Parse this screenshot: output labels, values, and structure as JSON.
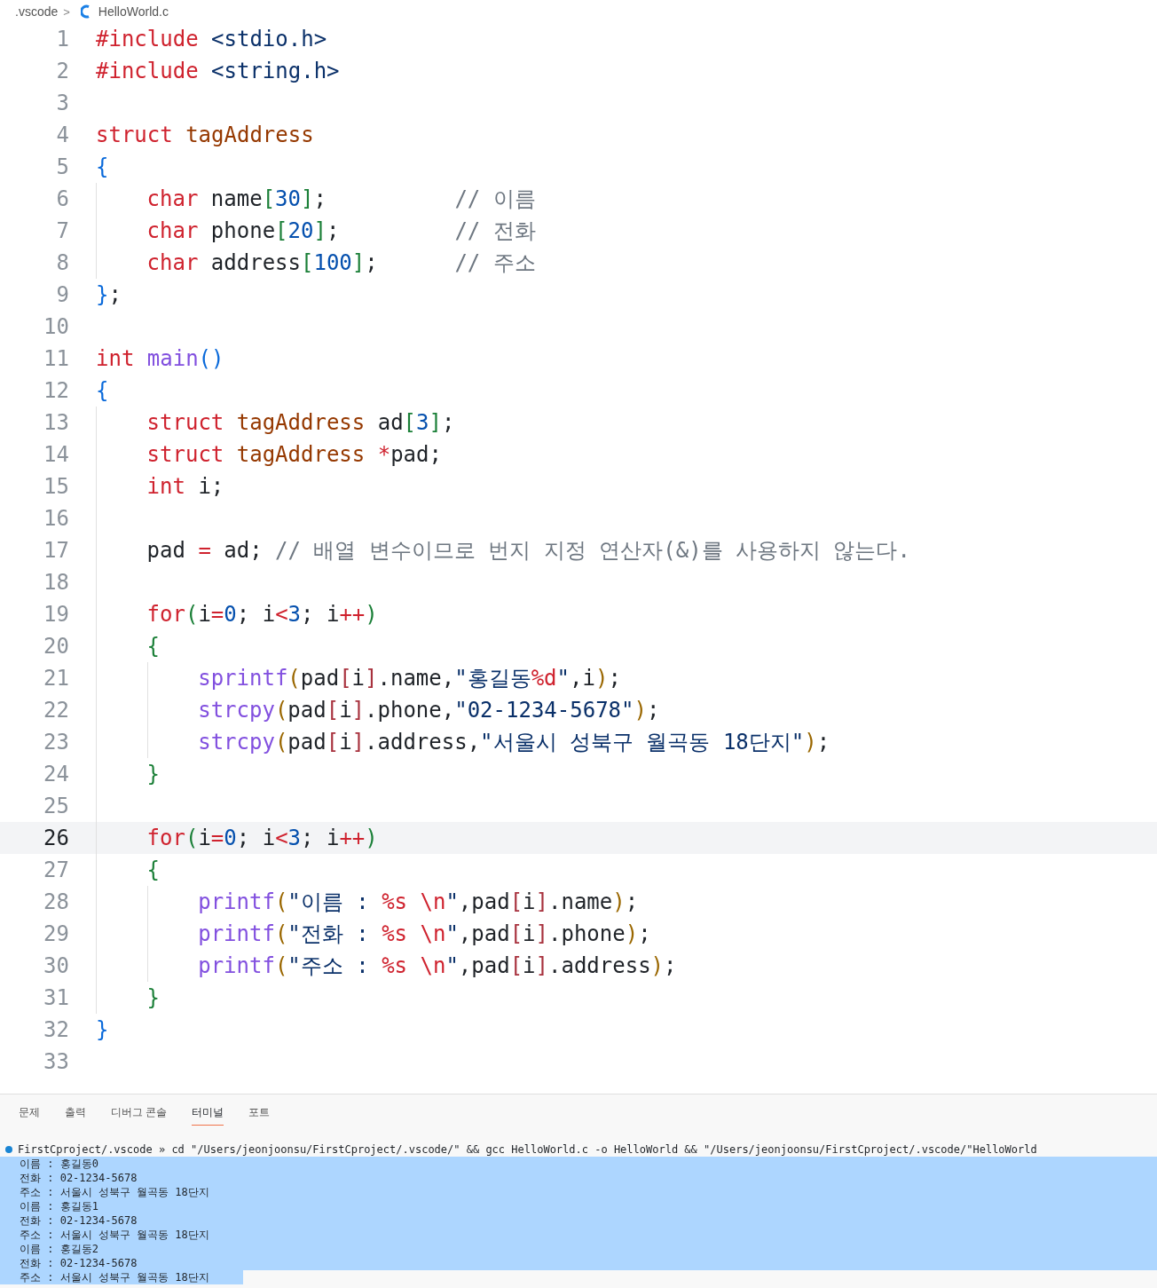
{
  "breadcrumb": {
    "folder": ".vscode",
    "separator": ">",
    "file": "HelloWorld.c"
  },
  "lines": [
    {
      "number": "1",
      "current": false,
      "tokens": [
        {
          "kind": "kw",
          "text": "#include "
        },
        {
          "kind": "str",
          "text": "<stdio.h>"
        }
      ]
    },
    {
      "number": "2",
      "current": false,
      "tokens": [
        {
          "kind": "kw",
          "text": "#include "
        },
        {
          "kind": "str",
          "text": "<string.h>"
        }
      ]
    },
    {
      "number": "3",
      "current": false
    },
    {
      "number": "4",
      "current": false,
      "tokens": [
        {
          "kind": "kw",
          "text": "struct "
        },
        {
          "kind": "type",
          "text": "tagAddress"
        }
      ]
    },
    {
      "number": "5",
      "current": false,
      "tokens": [
        {
          "kind": "b1",
          "text": "{"
        }
      ],
      "children": [
        {
          "number": "6",
          "current": false,
          "tokens": [
            {
              "kind": "kw",
              "text": "char"
            },
            {
              "kind": "p",
              "text": " name"
            },
            {
              "kind": "b2",
              "text": "["
            },
            {
              "kind": "num",
              "text": "30"
            },
            {
              "kind": "b2",
              "text": "]"
            },
            {
              "kind": "p",
              "text": ";          "
            },
            {
              "kind": "cm",
              "text": "// 이름"
            }
          ]
        },
        {
          "number": "7",
          "current": false,
          "tokens": [
            {
              "kind": "kw",
              "text": "char"
            },
            {
              "kind": "p",
              "text": " phone"
            },
            {
              "kind": "b2",
              "text": "["
            },
            {
              "kind": "num",
              "text": "20"
            },
            {
              "kind": "b2",
              "text": "]"
            },
            {
              "kind": "p",
              "text": ";         "
            },
            {
              "kind": "cm",
              "text": "// 전화"
            }
          ]
        },
        {
          "number": "8",
          "current": false,
          "tokens": [
            {
              "kind": "kw",
              "text": "char"
            },
            {
              "kind": "p",
              "text": " address"
            },
            {
              "kind": "b2",
              "text": "["
            },
            {
              "kind": "num",
              "text": "100"
            },
            {
              "kind": "b2",
              "text": "]"
            },
            {
              "kind": "p",
              "text": ";      "
            },
            {
              "kind": "cm",
              "text": "// 주소"
            }
          ]
        }
      ]
    },
    {
      "number": "9",
      "current": false,
      "tokens": [
        {
          "kind": "b1",
          "text": "}"
        },
        {
          "kind": "p",
          "text": ";"
        }
      ]
    },
    {
      "number": "10",
      "current": false
    },
    {
      "number": "11",
      "current": false,
      "tokens": [
        {
          "kind": "kw",
          "text": "int "
        },
        {
          "kind": "fn",
          "text": "main"
        },
        {
          "kind": "b1",
          "text": "()"
        }
      ]
    },
    {
      "number": "12",
      "current": false,
      "tokens": [
        {
          "kind": "b1",
          "text": "{"
        }
      ],
      "children": [
        {
          "number": "13",
          "current": false,
          "tokens": [
            {
              "kind": "kw",
              "text": "struct "
            },
            {
              "kind": "type",
              "text": "tagAddress"
            },
            {
              "kind": "p",
              "text": " ad"
            },
            {
              "kind": "b2",
              "text": "["
            },
            {
              "kind": "num",
              "text": "3"
            },
            {
              "kind": "b2",
              "text": "]"
            },
            {
              "kind": "p",
              "text": ";"
            }
          ]
        },
        {
          "number": "14",
          "current": false,
          "tokens": [
            {
              "kind": "kw",
              "text": "struct "
            },
            {
              "kind": "type",
              "text": "tagAddress "
            },
            {
              "kind": "op",
              "text": "*"
            },
            {
              "kind": "p",
              "text": "pad;"
            }
          ]
        },
        {
          "number": "15",
          "current": false,
          "tokens": [
            {
              "kind": "kw",
              "text": "int"
            },
            {
              "kind": "p",
              "text": " i;"
            }
          ]
        },
        {
          "number": "16",
          "current": false
        },
        {
          "number": "17",
          "current": false,
          "tokens": [
            {
              "kind": "p",
              "text": "pad "
            },
            {
              "kind": "op",
              "text": "="
            },
            {
              "kind": "p",
              "text": " ad; "
            },
            {
              "kind": "cm",
              "text": "// 배열 변수이므로 번지 지정 연산자(&)를 사용하지 않는다."
            }
          ]
        },
        {
          "number": "18",
          "current": false
        },
        {
          "number": "19",
          "current": false,
          "tokens": [
            {
              "kind": "kw",
              "text": "for"
            },
            {
              "kind": "b2",
              "text": "("
            },
            {
              "kind": "p",
              "text": "i"
            },
            {
              "kind": "op",
              "text": "="
            },
            {
              "kind": "num",
              "text": "0"
            },
            {
              "kind": "p",
              "text": "; i"
            },
            {
              "kind": "op",
              "text": "<"
            },
            {
              "kind": "num",
              "text": "3"
            },
            {
              "kind": "p",
              "text": "; i"
            },
            {
              "kind": "op",
              "text": "++"
            },
            {
              "kind": "b2",
              "text": ")"
            }
          ]
        },
        {
          "number": "20",
          "current": false,
          "tokens": [
            {
              "kind": "b2",
              "text": "{"
            }
          ],
          "children": [
            {
              "number": "21",
              "current": false,
              "tokens": [
                {
                  "kind": "fn",
                  "text": "sprintf"
                },
                {
                  "kind": "b3",
                  "text": "("
                },
                {
                  "kind": "p",
                  "text": "pad"
                },
                {
                  "kind": "b4",
                  "text": "["
                },
                {
                  "kind": "p",
                  "text": "i"
                },
                {
                  "kind": "b4",
                  "text": "]"
                },
                {
                  "kind": "p",
                  "text": ".name,"
                },
                {
                  "kind": "str",
                  "text": "\"홍길동"
                },
                {
                  "kind": "op",
                  "text": "%d"
                },
                {
                  "kind": "str",
                  "text": "\""
                },
                {
                  "kind": "p",
                  "text": ",i"
                },
                {
                  "kind": "b3",
                  "text": ")"
                },
                {
                  "kind": "p",
                  "text": ";"
                }
              ]
            },
            {
              "number": "22",
              "current": false,
              "tokens": [
                {
                  "kind": "fn",
                  "text": "strcpy"
                },
                {
                  "kind": "b3",
                  "text": "("
                },
                {
                  "kind": "p",
                  "text": "pad"
                },
                {
                  "kind": "b4",
                  "text": "["
                },
                {
                  "kind": "p",
                  "text": "i"
                },
                {
                  "kind": "b4",
                  "text": "]"
                },
                {
                  "kind": "p",
                  "text": ".phone,"
                },
                {
                  "kind": "str",
                  "text": "\"02-1234-5678\""
                },
                {
                  "kind": "b3",
                  "text": ")"
                },
                {
                  "kind": "p",
                  "text": ";"
                }
              ]
            },
            {
              "number": "23",
              "current": false,
              "tokens": [
                {
                  "kind": "fn",
                  "text": "strcpy"
                },
                {
                  "kind": "b3",
                  "text": "("
                },
                {
                  "kind": "p",
                  "text": "pad"
                },
                {
                  "kind": "b4",
                  "text": "["
                },
                {
                  "kind": "p",
                  "text": "i"
                },
                {
                  "kind": "b4",
                  "text": "]"
                },
                {
                  "kind": "p",
                  "text": ".address,"
                },
                {
                  "kind": "str",
                  "text": "\"서울시 성북구 월곡동 18단지\""
                },
                {
                  "kind": "b3",
                  "text": ")"
                },
                {
                  "kind": "p",
                  "text": ";"
                }
              ]
            }
          ]
        },
        {
          "number": "24",
          "current": false,
          "tokens": [
            {
              "kind": "b2",
              "text": "}"
            }
          ]
        },
        {
          "number": "25",
          "current": false
        },
        {
          "number": "26",
          "current": true,
          "tokens": [
            {
              "kind": "kw",
              "text": "for"
            },
            {
              "kind": "b2",
              "text": "("
            },
            {
              "kind": "p",
              "text": "i"
            },
            {
              "kind": "op",
              "text": "="
            },
            {
              "kind": "num",
              "text": "0"
            },
            {
              "kind": "p",
              "text": "; i"
            },
            {
              "kind": "op",
              "text": "<"
            },
            {
              "kind": "num",
              "text": "3"
            },
            {
              "kind": "p",
              "text": "; i"
            },
            {
              "kind": "op",
              "text": "++"
            },
            {
              "kind": "b2",
              "text": ")"
            }
          ]
        },
        {
          "number": "27",
          "current": false,
          "tokens": [
            {
              "kind": "b2",
              "text": "{"
            }
          ],
          "children": [
            {
              "number": "28",
              "current": false,
              "tokens": [
                {
                  "kind": "fn",
                  "text": "printf"
                },
                {
                  "kind": "b3",
                  "text": "("
                },
                {
                  "kind": "str",
                  "text": "\"이름 : "
                },
                {
                  "kind": "op",
                  "text": "%s"
                },
                {
                  "kind": "op",
                  "text": " \\n"
                },
                {
                  "kind": "str",
                  "text": "\""
                },
                {
                  "kind": "p",
                  "text": ",pad"
                },
                {
                  "kind": "b4",
                  "text": "["
                },
                {
                  "kind": "p",
                  "text": "i"
                },
                {
                  "kind": "b4",
                  "text": "]"
                },
                {
                  "kind": "p",
                  "text": ".name"
                },
                {
                  "kind": "b3",
                  "text": ")"
                },
                {
                  "kind": "p",
                  "text": ";"
                }
              ]
            },
            {
              "number": "29",
              "current": false,
              "tokens": [
                {
                  "kind": "fn",
                  "text": "printf"
                },
                {
                  "kind": "b3",
                  "text": "("
                },
                {
                  "kind": "str",
                  "text": "\"전화 : "
                },
                {
                  "kind": "op",
                  "text": "%s"
                },
                {
                  "kind": "op",
                  "text": " \\n"
                },
                {
                  "kind": "str",
                  "text": "\""
                },
                {
                  "kind": "p",
                  "text": ",pad"
                },
                {
                  "kind": "b4",
                  "text": "["
                },
                {
                  "kind": "p",
                  "text": "i"
                },
                {
                  "kind": "b4",
                  "text": "]"
                },
                {
                  "kind": "p",
                  "text": ".phone"
                },
                {
                  "kind": "b3",
                  "text": ")"
                },
                {
                  "kind": "p",
                  "text": ";"
                }
              ]
            },
            {
              "number": "30",
              "current": false,
              "tokens": [
                {
                  "kind": "fn",
                  "text": "printf"
                },
                {
                  "kind": "b3",
                  "text": "("
                },
                {
                  "kind": "str",
                  "text": "\"주소 : "
                },
                {
                  "kind": "op",
                  "text": "%s"
                },
                {
                  "kind": "op",
                  "text": " \\n"
                },
                {
                  "kind": "str",
                  "text": "\""
                },
                {
                  "kind": "p",
                  "text": ",pad"
                },
                {
                  "kind": "b4",
                  "text": "["
                },
                {
                  "kind": "p",
                  "text": "i"
                },
                {
                  "kind": "b4",
                  "text": "]"
                },
                {
                  "kind": "p",
                  "text": ".address"
                },
                {
                  "kind": "b3",
                  "text": ")"
                },
                {
                  "kind": "p",
                  "text": ";"
                }
              ]
            }
          ]
        },
        {
          "number": "31",
          "current": false,
          "tokens": [
            {
              "kind": "b2",
              "text": "}"
            }
          ]
        }
      ]
    },
    {
      "number": "32",
      "current": false,
      "tokens": [
        {
          "kind": "b1",
          "text": "}"
        }
      ]
    },
    {
      "number": "33",
      "current": false
    }
  ],
  "panel_tabs": [
    {
      "label": "문제",
      "selected": false
    },
    {
      "label": "출력",
      "selected": false
    },
    {
      "label": "디버그 콘솔",
      "selected": false
    },
    {
      "label": "터미널",
      "selected": true
    },
    {
      "label": "포트",
      "selected": false
    }
  ],
  "terminal": {
    "command": "FirstCproject/.vscode » cd \"/Users/jeonjoonsu/FirstCproject/.vscode/\" && gcc HelloWorld.c -o HelloWorld && \"/Users/jeonjoonsu/FirstCproject/.vscode/\"HelloWorld",
    "output": [
      {
        "text": "이름 : 홍길동0",
        "selected": true
      },
      {
        "text": "전화 : 02-1234-5678",
        "selected": true
      },
      {
        "text": "주소 : 서울시 성북구 월곡동 18단지",
        "selected": true
      },
      {
        "text": "이름 : 홍길동1",
        "selected": true
      },
      {
        "text": "전화 : 02-1234-5678",
        "selected": true
      },
      {
        "text": "주소 : 서울시 성북구 월곡동 18단지",
        "selected": true
      },
      {
        "text": "이름 : 홍길동2",
        "selected": true
      },
      {
        "text": "전화 : 02-1234-5678",
        "selected": true
      },
      {
        "text": "주소 : 서울시 성북구 월곡동 18단지",
        "selected": true
      }
    ]
  }
}
